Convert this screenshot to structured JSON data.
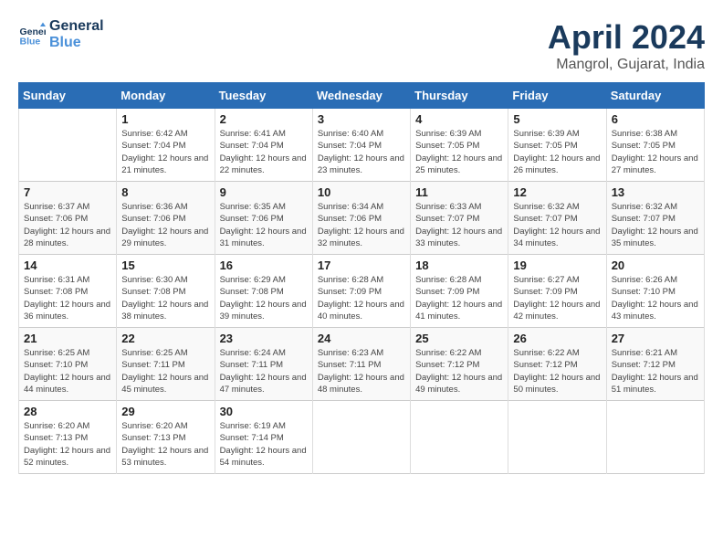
{
  "header": {
    "logo_line1": "General",
    "logo_line2": "Blue",
    "month": "April 2024",
    "location": "Mangrol, Gujarat, India"
  },
  "days_of_week": [
    "Sunday",
    "Monday",
    "Tuesday",
    "Wednesday",
    "Thursday",
    "Friday",
    "Saturday"
  ],
  "weeks": [
    [
      {
        "day": "",
        "sunrise": "",
        "sunset": "",
        "daylight": ""
      },
      {
        "day": "1",
        "sunrise": "Sunrise: 6:42 AM",
        "sunset": "Sunset: 7:04 PM",
        "daylight": "Daylight: 12 hours and 21 minutes."
      },
      {
        "day": "2",
        "sunrise": "Sunrise: 6:41 AM",
        "sunset": "Sunset: 7:04 PM",
        "daylight": "Daylight: 12 hours and 22 minutes."
      },
      {
        "day": "3",
        "sunrise": "Sunrise: 6:40 AM",
        "sunset": "Sunset: 7:04 PM",
        "daylight": "Daylight: 12 hours and 23 minutes."
      },
      {
        "day": "4",
        "sunrise": "Sunrise: 6:39 AM",
        "sunset": "Sunset: 7:05 PM",
        "daylight": "Daylight: 12 hours and 25 minutes."
      },
      {
        "day": "5",
        "sunrise": "Sunrise: 6:39 AM",
        "sunset": "Sunset: 7:05 PM",
        "daylight": "Daylight: 12 hours and 26 minutes."
      },
      {
        "day": "6",
        "sunrise": "Sunrise: 6:38 AM",
        "sunset": "Sunset: 7:05 PM",
        "daylight": "Daylight: 12 hours and 27 minutes."
      }
    ],
    [
      {
        "day": "7",
        "sunrise": "Sunrise: 6:37 AM",
        "sunset": "Sunset: 7:06 PM",
        "daylight": "Daylight: 12 hours and 28 minutes."
      },
      {
        "day": "8",
        "sunrise": "Sunrise: 6:36 AM",
        "sunset": "Sunset: 7:06 PM",
        "daylight": "Daylight: 12 hours and 29 minutes."
      },
      {
        "day": "9",
        "sunrise": "Sunrise: 6:35 AM",
        "sunset": "Sunset: 7:06 PM",
        "daylight": "Daylight: 12 hours and 31 minutes."
      },
      {
        "day": "10",
        "sunrise": "Sunrise: 6:34 AM",
        "sunset": "Sunset: 7:06 PM",
        "daylight": "Daylight: 12 hours and 32 minutes."
      },
      {
        "day": "11",
        "sunrise": "Sunrise: 6:33 AM",
        "sunset": "Sunset: 7:07 PM",
        "daylight": "Daylight: 12 hours and 33 minutes."
      },
      {
        "day": "12",
        "sunrise": "Sunrise: 6:32 AM",
        "sunset": "Sunset: 7:07 PM",
        "daylight": "Daylight: 12 hours and 34 minutes."
      },
      {
        "day": "13",
        "sunrise": "Sunrise: 6:32 AM",
        "sunset": "Sunset: 7:07 PM",
        "daylight": "Daylight: 12 hours and 35 minutes."
      }
    ],
    [
      {
        "day": "14",
        "sunrise": "Sunrise: 6:31 AM",
        "sunset": "Sunset: 7:08 PM",
        "daylight": "Daylight: 12 hours and 36 minutes."
      },
      {
        "day": "15",
        "sunrise": "Sunrise: 6:30 AM",
        "sunset": "Sunset: 7:08 PM",
        "daylight": "Daylight: 12 hours and 38 minutes."
      },
      {
        "day": "16",
        "sunrise": "Sunrise: 6:29 AM",
        "sunset": "Sunset: 7:08 PM",
        "daylight": "Daylight: 12 hours and 39 minutes."
      },
      {
        "day": "17",
        "sunrise": "Sunrise: 6:28 AM",
        "sunset": "Sunset: 7:09 PM",
        "daylight": "Daylight: 12 hours and 40 minutes."
      },
      {
        "day": "18",
        "sunrise": "Sunrise: 6:28 AM",
        "sunset": "Sunset: 7:09 PM",
        "daylight": "Daylight: 12 hours and 41 minutes."
      },
      {
        "day": "19",
        "sunrise": "Sunrise: 6:27 AM",
        "sunset": "Sunset: 7:09 PM",
        "daylight": "Daylight: 12 hours and 42 minutes."
      },
      {
        "day": "20",
        "sunrise": "Sunrise: 6:26 AM",
        "sunset": "Sunset: 7:10 PM",
        "daylight": "Daylight: 12 hours and 43 minutes."
      }
    ],
    [
      {
        "day": "21",
        "sunrise": "Sunrise: 6:25 AM",
        "sunset": "Sunset: 7:10 PM",
        "daylight": "Daylight: 12 hours and 44 minutes."
      },
      {
        "day": "22",
        "sunrise": "Sunrise: 6:25 AM",
        "sunset": "Sunset: 7:11 PM",
        "daylight": "Daylight: 12 hours and 45 minutes."
      },
      {
        "day": "23",
        "sunrise": "Sunrise: 6:24 AM",
        "sunset": "Sunset: 7:11 PM",
        "daylight": "Daylight: 12 hours and 47 minutes."
      },
      {
        "day": "24",
        "sunrise": "Sunrise: 6:23 AM",
        "sunset": "Sunset: 7:11 PM",
        "daylight": "Daylight: 12 hours and 48 minutes."
      },
      {
        "day": "25",
        "sunrise": "Sunrise: 6:22 AM",
        "sunset": "Sunset: 7:12 PM",
        "daylight": "Daylight: 12 hours and 49 minutes."
      },
      {
        "day": "26",
        "sunrise": "Sunrise: 6:22 AM",
        "sunset": "Sunset: 7:12 PM",
        "daylight": "Daylight: 12 hours and 50 minutes."
      },
      {
        "day": "27",
        "sunrise": "Sunrise: 6:21 AM",
        "sunset": "Sunset: 7:12 PM",
        "daylight": "Daylight: 12 hours and 51 minutes."
      }
    ],
    [
      {
        "day": "28",
        "sunrise": "Sunrise: 6:20 AM",
        "sunset": "Sunset: 7:13 PM",
        "daylight": "Daylight: 12 hours and 52 minutes."
      },
      {
        "day": "29",
        "sunrise": "Sunrise: 6:20 AM",
        "sunset": "Sunset: 7:13 PM",
        "daylight": "Daylight: 12 hours and 53 minutes."
      },
      {
        "day": "30",
        "sunrise": "Sunrise: 6:19 AM",
        "sunset": "Sunset: 7:14 PM",
        "daylight": "Daylight: 12 hours and 54 minutes."
      },
      {
        "day": "",
        "sunrise": "",
        "sunset": "",
        "daylight": ""
      },
      {
        "day": "",
        "sunrise": "",
        "sunset": "",
        "daylight": ""
      },
      {
        "day": "",
        "sunrise": "",
        "sunset": "",
        "daylight": ""
      },
      {
        "day": "",
        "sunrise": "",
        "sunset": "",
        "daylight": ""
      }
    ]
  ]
}
